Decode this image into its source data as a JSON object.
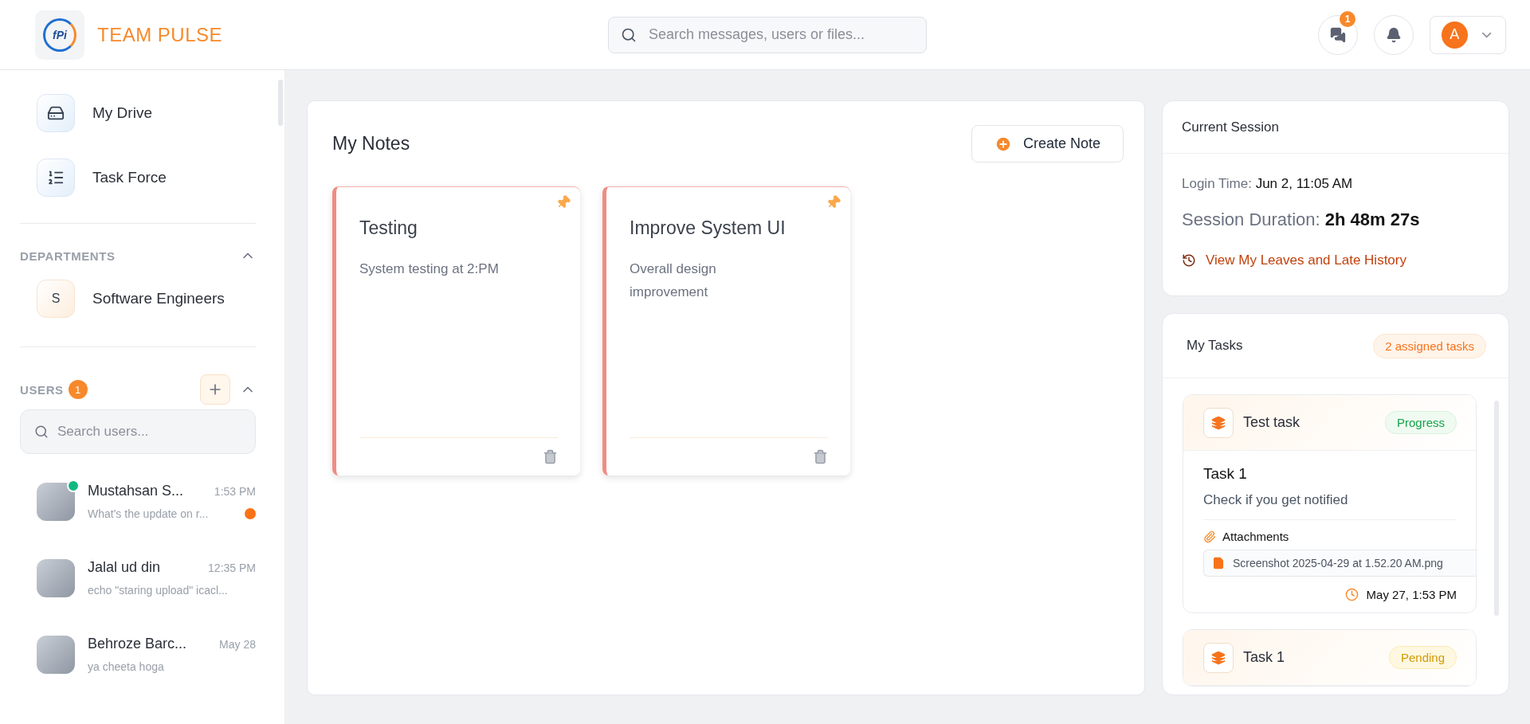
{
  "header": {
    "logo_text": "fPi",
    "app_name": "TEAM PULSE",
    "search": {
      "placeholder": "Search messages, users or files..."
    },
    "chat_badge": "1",
    "avatar_initial": "A"
  },
  "sidebar": {
    "nav": [
      {
        "label": "My Drive",
        "kind": "drive"
      },
      {
        "label": "Task Force",
        "kind": "tasks"
      }
    ],
    "departments": {
      "title": "DEPARTMENTS",
      "expanded": true,
      "items": [
        {
          "initial": "S",
          "name": "Software Engineers"
        }
      ]
    },
    "users": {
      "title": "USERS",
      "count": "1",
      "expanded": true,
      "search": {
        "placeholder": "Search users..."
      },
      "items": [
        {
          "name": "Mustahsan S...",
          "time": "1:53 PM",
          "preview": "What's the update on r...",
          "online": true,
          "unread": true
        },
        {
          "name": "Jalal ud din",
          "time": "12:35 PM",
          "preview": "echo \"staring upload\" icacl...",
          "online": false,
          "unread": false
        },
        {
          "name": "Behroze Barc...",
          "time": "May 28",
          "preview": "ya cheeta hoga",
          "online": false,
          "unread": false
        }
      ]
    }
  },
  "notes": {
    "title": "My Notes",
    "create_button": "Create Note",
    "items": [
      {
        "title": "Testing",
        "text": "System testing at 2:PM",
        "pinned": true
      },
      {
        "title": "Improve System UI",
        "text": "Overall design improvement",
        "pinned": true
      }
    ]
  },
  "session": {
    "title": "Current Session",
    "login_label": "Login Time:",
    "login_value": "Jun 2, 11:05 AM",
    "duration_label": "Session Duration:",
    "duration_value": "2h 48m 27s",
    "history_link": "View My Leaves and Late History"
  },
  "tasks": {
    "title": "My Tasks",
    "count_badge": "2 assigned tasks",
    "items": [
      {
        "project": "Test task",
        "status": "Progress",
        "kind": "progress",
        "title": "Task 1",
        "description": "Check if you get notified",
        "attachments_label": "Attachments",
        "attachments": [
          "Screenshot 2025-04-29 at 1.52.20 AM.png"
        ],
        "date": "May 27, 1:53 PM"
      },
      {
        "project": "Task 1",
        "status": "Pending",
        "kind": "pending"
      }
    ]
  }
}
